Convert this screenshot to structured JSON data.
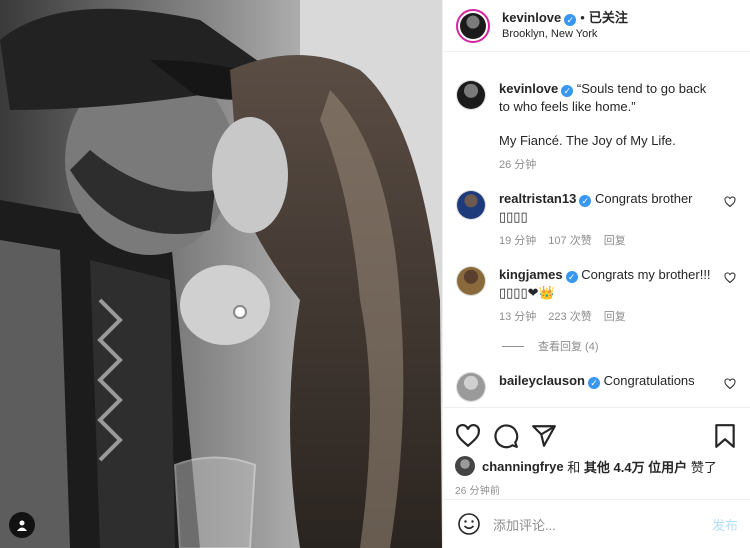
{
  "post": {
    "username": "kevinlove",
    "separator": "•",
    "follow_status": "已关注",
    "location": "Brooklyn, New York"
  },
  "caption": {
    "username": "kevinlove",
    "line1": "“Souls tend to go back to who feels like home.”",
    "line2": "My Fiancé. The Joy of My Life.",
    "time": "26 分钟"
  },
  "comments": [
    {
      "username": "realtristan13",
      "text": "Congrats brother ▯▯▯▯",
      "time": "19 分钟",
      "likes": "107 次赞",
      "reply": "回复"
    },
    {
      "username": "kingjames",
      "text": "Congrats my brother!!! ▯▯▯▯❤👑",
      "time": "13 分钟",
      "likes": "223 次赞",
      "reply": "回复"
    },
    {
      "username": "baileyclauson",
      "text": "Congratulations",
      "time": "",
      "likes": "",
      "reply": ""
    }
  ],
  "view_replies": "查看回复 (4)",
  "likes_line": {
    "user": "channingfrye",
    "rest_prefix": "和",
    "others": "其他 4.4万 位用户",
    "suffix": "赞了"
  },
  "post_time": "26 分钟前",
  "add_comment": {
    "placeholder": "添加评论...",
    "post_label": "发布"
  },
  "colors": {
    "link": "#3897f0",
    "post_disabled": "#b2dffc",
    "muted": "#8e8e8e"
  },
  "icons": [
    "heart-icon",
    "comment-icon",
    "share-icon",
    "bookmark-icon",
    "emoji-icon",
    "user-tag-icon",
    "verified-badge-icon"
  ]
}
